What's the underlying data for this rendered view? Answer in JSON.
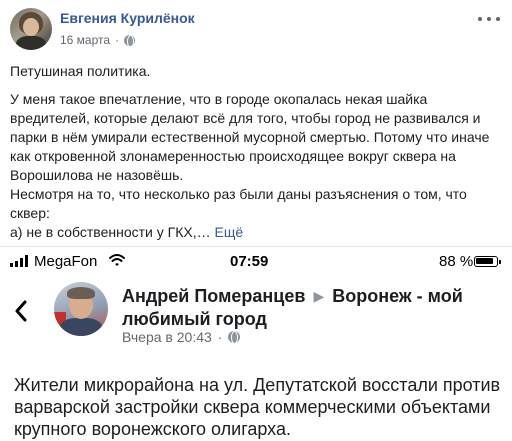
{
  "post": {
    "author": "Евгения Курилёнок",
    "date": "16 марта",
    "date_separator": "·",
    "title": "Петушиная политика.",
    "paragraphs": [
      "У меня такое впечатление, что в городе окопалась некая шайка вредителей, которые делают всё для того, чтобы город не развивался и парки в нём умирали естественной мусорной смертью. Потому что иначе как откровенной злонамеренностью происходящее вокруг сквера на Ворошилова не назовёшь.",
      "Несмотря на то, что несколько раз были даны разъяснения о том, что сквер:",
      "а) не в собственности у ГКХ,…"
    ],
    "see_more": "Ещё",
    "icons": {
      "privacy": "globe-icon",
      "menu": "more-icon"
    }
  },
  "screenshot": {
    "status": {
      "carrier": "MegaFon",
      "time": "07:59",
      "battery": "88 %",
      "icons": [
        "signal-icon",
        "wifi-icon",
        "battery-icon"
      ]
    },
    "group_post": {
      "author": "Андрей Померанцев",
      "group": "Воронеж - мой любимый город",
      "time": "Вчера в 20:43",
      "separator": "·",
      "text": "Жители микрорайона на ул. Депутатской восстали против варварской застройки сквера коммерческими объектами крупного воронежского олигарха.",
      "icons": {
        "back": "back-icon",
        "arrow": "▶",
        "privacy": "globe-icon"
      }
    }
  }
}
